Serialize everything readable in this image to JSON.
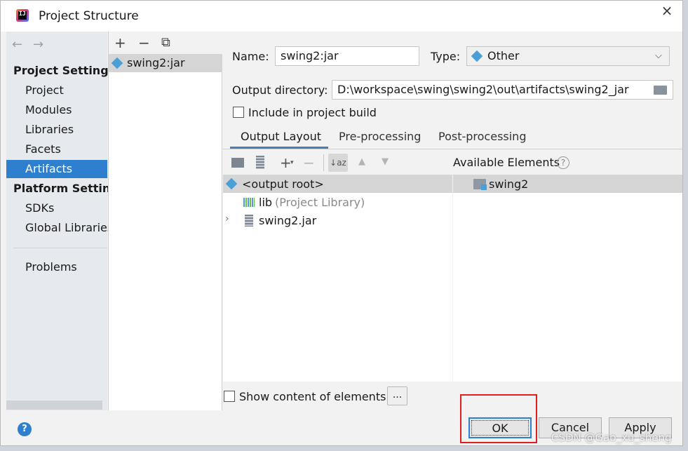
{
  "window": {
    "title": "Project Structure",
    "close_glyph": "×"
  },
  "nav": {
    "back_glyph": "←",
    "forward_glyph": "→",
    "project_settings_header": "Project Settings",
    "project_settings_items": [
      "Project",
      "Modules",
      "Libraries",
      "Facets",
      "Artifacts"
    ],
    "selected": "Artifacts",
    "platform_settings_header": "Platform Setting",
    "platform_items": [
      "SDKs",
      "Global Libraries"
    ],
    "problems": "Problems"
  },
  "artifacts_list": {
    "add_glyph": "+",
    "remove_glyph": "−",
    "copy_glyph": "⧉",
    "items": [
      "swing2:jar"
    ]
  },
  "form": {
    "name_label": "Name:",
    "name_value": "swing2:jar",
    "type_label": "Type:",
    "type_value": "Other",
    "output_dir_label": "Output directory:",
    "output_dir_value": "D:\\workspace\\swing\\swing2\\out\\artifacts\\swing2_jar",
    "include_build_label": "Include in project build",
    "include_build_checked": false
  },
  "tabs": [
    "Output Layout",
    "Pre-processing",
    "Post-processing"
  ],
  "active_tab": "Output Layout",
  "layout_tree": [
    {
      "label": "<output root>",
      "suffix": ""
    },
    {
      "label": "lib",
      "suffix": "(Project Library)"
    },
    {
      "label": "swing2.jar",
      "suffix": ""
    }
  ],
  "available": {
    "title": "Available Elements",
    "help_glyph": "?",
    "items": [
      "swing2"
    ]
  },
  "show_content_label": "Show content of elements",
  "dots_label": "...",
  "buttons": {
    "ok": "OK",
    "cancel": "Cancel",
    "apply": "Apply"
  },
  "help_glyph": "?",
  "watermark": "CSDN @Gao_xu_sheng",
  "colors": {
    "selection": "#2f7fcf",
    "highlight_box": "#e02020",
    "artifact_icon": "#4a9fd8"
  }
}
